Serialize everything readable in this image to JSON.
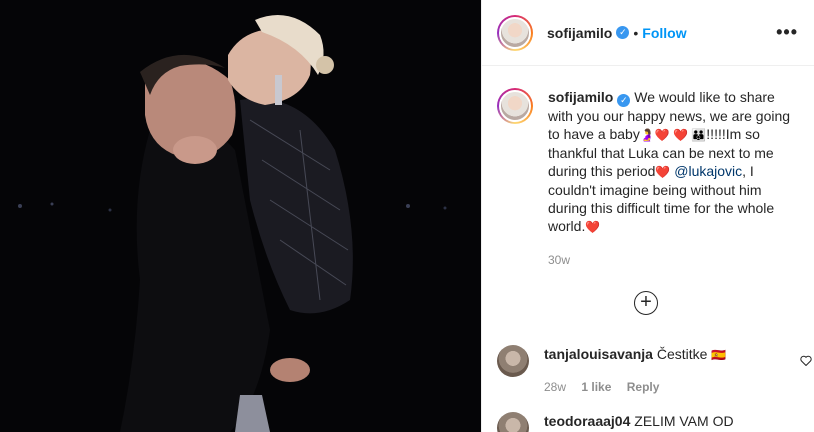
{
  "post": {
    "username": "sofijamilo",
    "verified_glyph": "✓",
    "separator": "•",
    "follow_label": "Follow",
    "more_label": "•••"
  },
  "caption": {
    "username": "sofijamilo",
    "part1": "We would like to share with you our happy news, we are going to have a baby",
    "emoji1": "🤰❤️ ❤️ 👪",
    "part2": "!!!!!Im so thankful that Luka can be next to me during this period",
    "emoji2": "❤️",
    "mention": "@lukajovic",
    "part3": ", I couldn't imagine being without him during this difficult time for the whole world.",
    "emoji3": "❤️",
    "time": "30w"
  },
  "load_more_label": "+",
  "comments": [
    {
      "username": "tanjalouisavanja",
      "text": "Čestitke",
      "emoji": "🇪🇸",
      "time": "28w",
      "likes": "1 like",
      "reply": "Reply"
    },
    {
      "username": "teodoraaaj04",
      "text": "ZELIM VAM OD"
    }
  ],
  "colors": {
    "accent": "#0095f6",
    "verified": "#3897f0",
    "mention": "#00376b",
    "muted": "#8e8e8e"
  }
}
